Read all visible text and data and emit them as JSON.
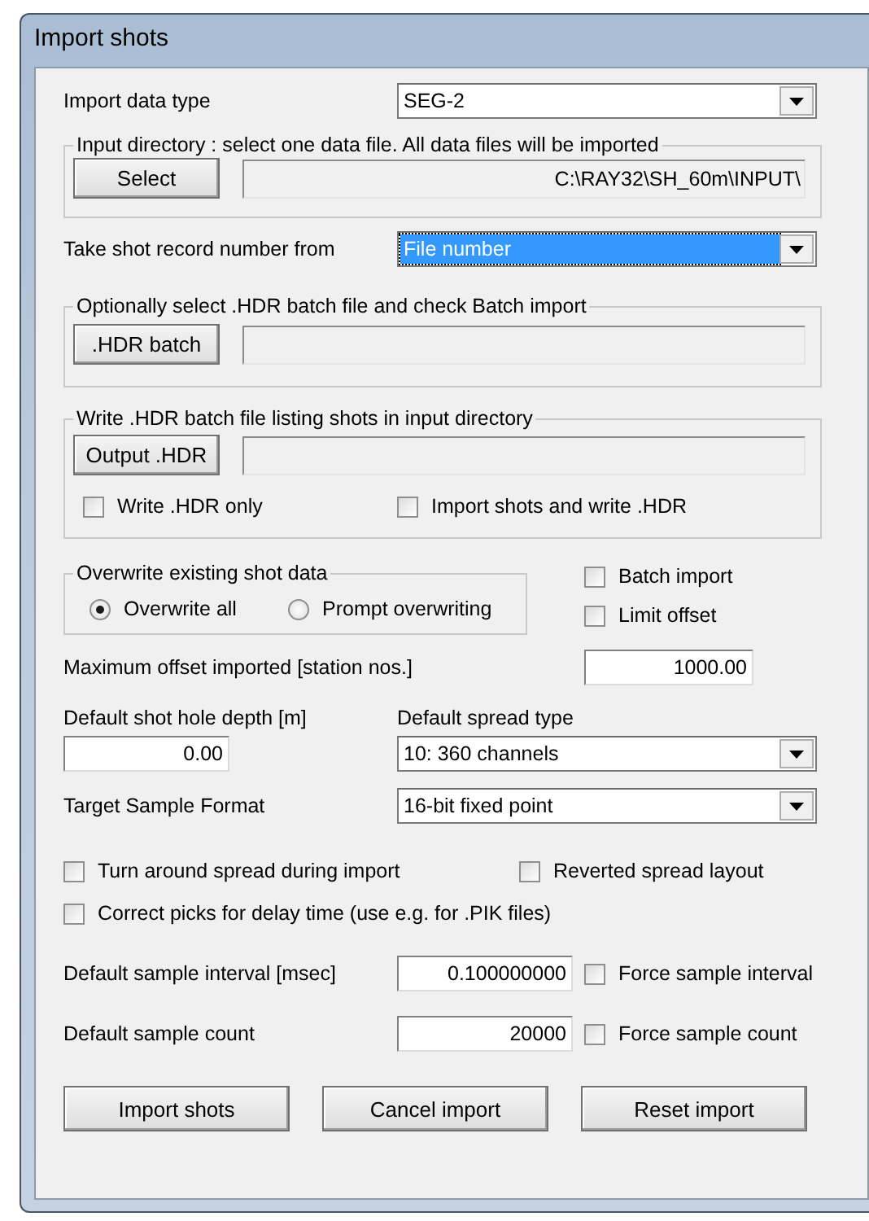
{
  "window": {
    "title": "Import shots"
  },
  "import_data_type": {
    "label": "Import data type",
    "value": "SEG-2"
  },
  "input_directory": {
    "legend": "Input directory : select one data file. All data files will be imported",
    "button": "Select",
    "path": "C:\\RAY32\\SH_60m\\INPUT\\"
  },
  "shot_record_number": {
    "label": "Take shot record number from",
    "value": "File number",
    "focused": true
  },
  "hdr_batch": {
    "legend": "Optionally select .HDR batch file and check Batch import",
    "button": ".HDR batch"
  },
  "write_hdr": {
    "legend": "Write .HDR batch file listing shots in input directory",
    "button": "Output .HDR",
    "options": [
      {
        "label": "Write .HDR only",
        "checked": false
      },
      {
        "label": "Import shots and write .HDR",
        "checked": false
      }
    ]
  },
  "overwrite": {
    "legend": "Overwrite existing shot data",
    "options": [
      {
        "label": "Overwrite all",
        "selected": true
      },
      {
        "label": "Prompt overwriting",
        "selected": false
      }
    ]
  },
  "side_checks": [
    {
      "label": "Batch import",
      "checked": false
    },
    {
      "label": "Limit offset",
      "checked": false
    }
  ],
  "max_offset": {
    "label": "Maximum offset imported [station nos.]",
    "value": "1000.00"
  },
  "shot_hole_depth": {
    "label": "Default shot hole depth [m]",
    "value": "0.00"
  },
  "spread_type": {
    "label": "Default spread type",
    "value": "10: 360 channels"
  },
  "sample_format": {
    "label": "Target Sample Format",
    "value": "16-bit fixed point"
  },
  "spread_checks": [
    {
      "label": "Turn around spread during import",
      "checked": false
    },
    {
      "label": "Reverted spread layout",
      "checked": false
    },
    {
      "label": "Correct picks for delay time (use e.g. for .PIK files)",
      "checked": false
    }
  ],
  "sample_interval": {
    "label": "Default sample interval [msec]",
    "value": "0.100000000",
    "force": {
      "label": "Force sample interval",
      "checked": false
    }
  },
  "sample_count": {
    "label": "Default sample count",
    "value": "20000",
    "force": {
      "label": "Force sample count",
      "checked": false
    }
  },
  "buttons": [
    "Import shots",
    "Cancel import",
    "Reset import"
  ]
}
